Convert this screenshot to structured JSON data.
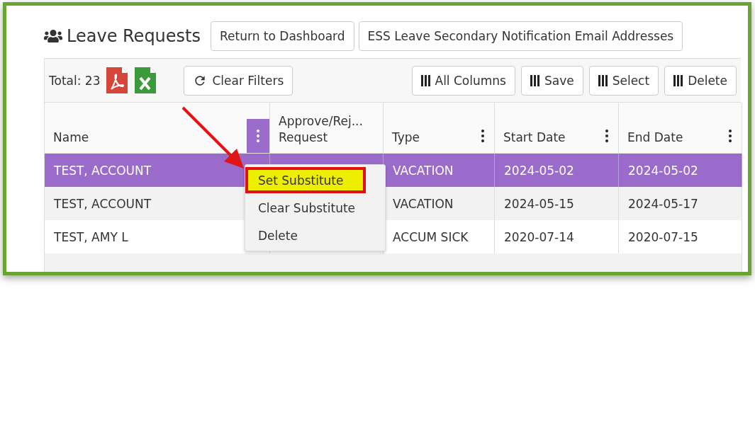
{
  "title": "Leave Requests",
  "header_buttons": [
    "Return to Dashboard",
    "ESS Leave Secondary Notification Email Addresses"
  ],
  "toolbar": {
    "total": "Total: 23",
    "clear_filters": "Clear Filters",
    "column_buttons": [
      "All Columns",
      "Save",
      "Select",
      "Delete"
    ]
  },
  "table": {
    "columns": [
      {
        "label": "Name",
        "kind": "menu",
        "menu_active": true
      },
      {
        "label": "Approve/Rej...\nRequest",
        "kind": "plain"
      },
      {
        "label": "Type",
        "kind": "menu",
        "menu_active": false
      },
      {
        "label": "Start Date",
        "kind": "menu",
        "menu_active": false
      },
      {
        "label": "End Date",
        "kind": "menu",
        "menu_active": false
      }
    ],
    "rows": [
      {
        "selected": true,
        "cells": [
          "TEST, ACCOUNT",
          "",
          "VACATION",
          "2024-05-02",
          "2024-05-02"
        ]
      },
      {
        "selected": false,
        "cells": [
          "TEST, ACCOUNT",
          "",
          "VACATION",
          "2024-05-15",
          "2024-05-17"
        ]
      },
      {
        "selected": false,
        "cells": [
          "TEST, AMY L",
          "",
          "ACCUM SICK",
          "2020-07-14",
          "2020-07-15"
        ]
      }
    ]
  },
  "context_menu": {
    "items": [
      {
        "label": "Set Substitute",
        "highlighted": true
      },
      {
        "label": "Clear Substitute",
        "highlighted": false
      },
      {
        "label": "Delete",
        "highlighted": false
      }
    ]
  }
}
